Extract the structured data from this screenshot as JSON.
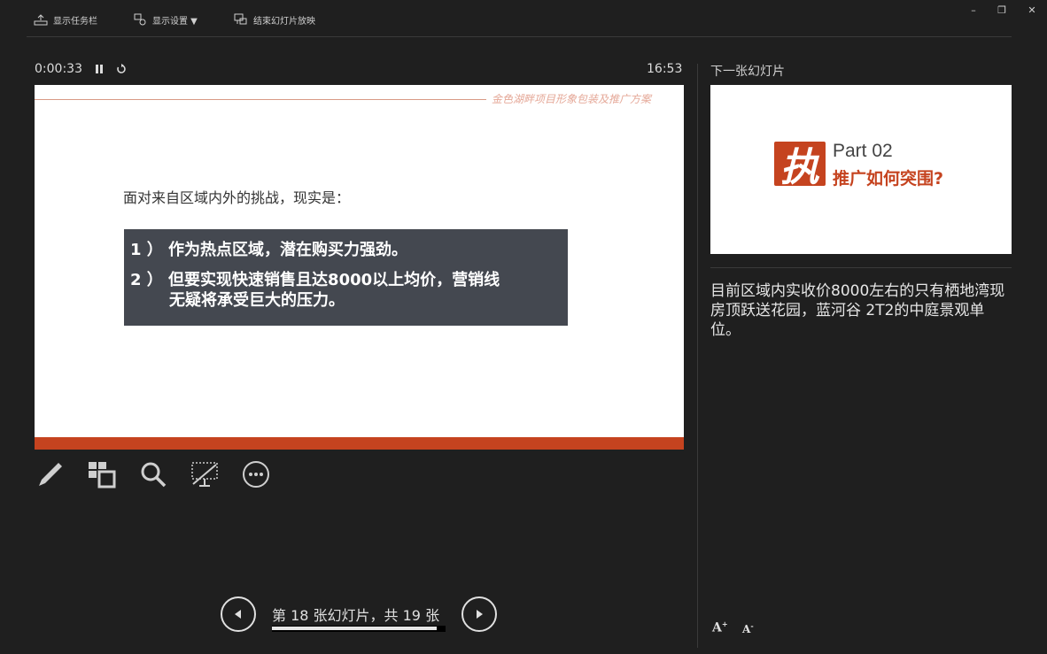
{
  "toolbar": {
    "taskbar_label": "显示任务栏",
    "display_settings_label": "显示设置 ▼",
    "end_show_label": "结束幻灯片放映"
  },
  "window_controls": {
    "minimize": "–",
    "restore": "❐",
    "close": "✕"
  },
  "timer": {
    "elapsed": "0:00:33",
    "clock": "16:53"
  },
  "current_slide": {
    "header": "金色湖畔项目形象包装及推广方案",
    "intro": "面对来自区域内外的挑战，现实是：",
    "point1": "1 ） 作为热点区域，潜在购买力强劲。",
    "point2": "2 ） 但要实现快速销售且达8000以上均价，营销线",
    "point2_cont": "无疑将承受巨大的压力。"
  },
  "tools": {
    "pen": "pen-icon",
    "grid": "slides-grid-icon",
    "zoom": "zoom-icon",
    "screen": "black-screen-icon",
    "more": "more-icon"
  },
  "next_slide": {
    "label": "下一张幻灯片",
    "big_char": "执",
    "part": "Part 02",
    "subtitle": "推广如何突围?"
  },
  "notes": {
    "text": "目前区域内实收价8000左右的只有栖地湾现房顶跃送花园，蓝河谷 2T2的中庭景观单位。"
  },
  "font_controls": {
    "increase": "A",
    "decrease": "A"
  },
  "navigation": {
    "label": "第 18 张幻灯片，共 19 张",
    "progress": 0.947
  },
  "colors": {
    "accent": "#c5431f",
    "box": "#444850",
    "background": "#1f1f1f"
  }
}
